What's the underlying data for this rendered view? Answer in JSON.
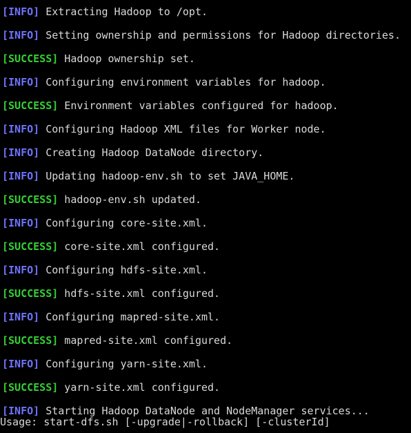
{
  "colors": {
    "background": "#000000",
    "text": "#d9d9d9",
    "info_tag": "#6f74ff",
    "success_tag": "#35d035"
  },
  "log": [
    {
      "tag": "[INFO]",
      "level": "info",
      "text": " Extracting Hadoop to /opt."
    },
    {
      "tag": "[INFO]",
      "level": "info",
      "text": " Setting ownership and permissions for Hadoop directories."
    },
    {
      "tag": "[SUCCESS]",
      "level": "success",
      "text": " Hadoop ownership set."
    },
    {
      "tag": "[INFO]",
      "level": "info",
      "text": " Configuring environment variables for hadoop."
    },
    {
      "tag": "[SUCCESS]",
      "level": "success",
      "text": " Environment variables configured for hadoop."
    },
    {
      "tag": "[INFO]",
      "level": "info",
      "text": " Configuring Hadoop XML files for Worker node."
    },
    {
      "tag": "[INFO]",
      "level": "info",
      "text": " Creating Hadoop DataNode directory."
    },
    {
      "tag": "[INFO]",
      "level": "info",
      "text": " Updating hadoop-env.sh to set JAVA_HOME."
    },
    {
      "tag": "[SUCCESS]",
      "level": "success",
      "text": " hadoop-env.sh updated."
    },
    {
      "tag": "[INFO]",
      "level": "info",
      "text": " Configuring core-site.xml."
    },
    {
      "tag": "[SUCCESS]",
      "level": "success",
      "text": " core-site.xml configured."
    },
    {
      "tag": "[INFO]",
      "level": "info",
      "text": " Configuring hdfs-site.xml."
    },
    {
      "tag": "[SUCCESS]",
      "level": "success",
      "text": " hdfs-site.xml configured."
    },
    {
      "tag": "[INFO]",
      "level": "info",
      "text": " Configuring mapred-site.xml."
    },
    {
      "tag": "[SUCCESS]",
      "level": "success",
      "text": " mapred-site.xml configured."
    },
    {
      "tag": "[INFO]",
      "level": "info",
      "text": " Configuring yarn-site.xml."
    },
    {
      "tag": "[SUCCESS]",
      "level": "success",
      "text": " yarn-site.xml configured."
    },
    {
      "tag": "[INFO]",
      "level": "info",
      "text": " Starting Hadoop DataNode and NodeManager services..."
    }
  ],
  "usage_line": "Usage: start-dfs.sh [-upgrade|-rollback] [-clusterId]"
}
